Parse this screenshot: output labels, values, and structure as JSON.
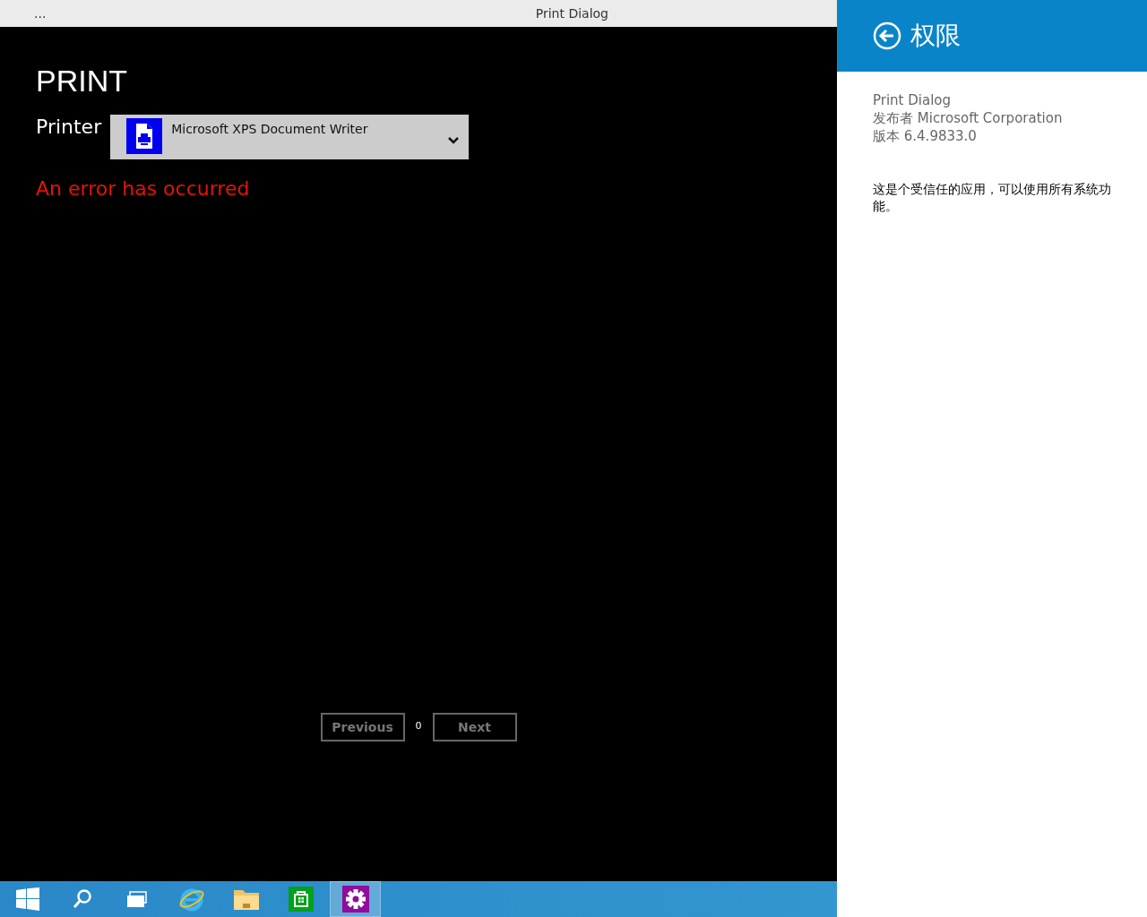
{
  "title_bar": {
    "menu": "...",
    "title": "Print Dialog"
  },
  "print": {
    "heading": "PRINT",
    "printer_label": "Printer",
    "printer_value": "Microsoft XPS Document Writer",
    "error": "An error has occurred"
  },
  "pager": {
    "previous": {
      "label": "Previous",
      "disabled": true
    },
    "page": "0",
    "next": {
      "label": "Next",
      "disabled": true
    }
  },
  "taskbar": [
    {
      "kind": "start",
      "selected": false
    },
    {
      "kind": "search",
      "selected": false
    },
    {
      "kind": "taskview",
      "selected": false
    },
    {
      "kind": "browser",
      "selected": false
    },
    {
      "kind": "folder",
      "selected": false
    },
    {
      "kind": "store",
      "selected": false
    },
    {
      "kind": "settings",
      "selected": true
    }
  ],
  "permissions": {
    "title": "权限",
    "app_name": "Print Dialog",
    "publisher": "发布者 Microsoft Corporation",
    "version": "版本 6.4.9833.0",
    "description": "这是个受信任的应用，可以使用所有系统功能。"
  }
}
